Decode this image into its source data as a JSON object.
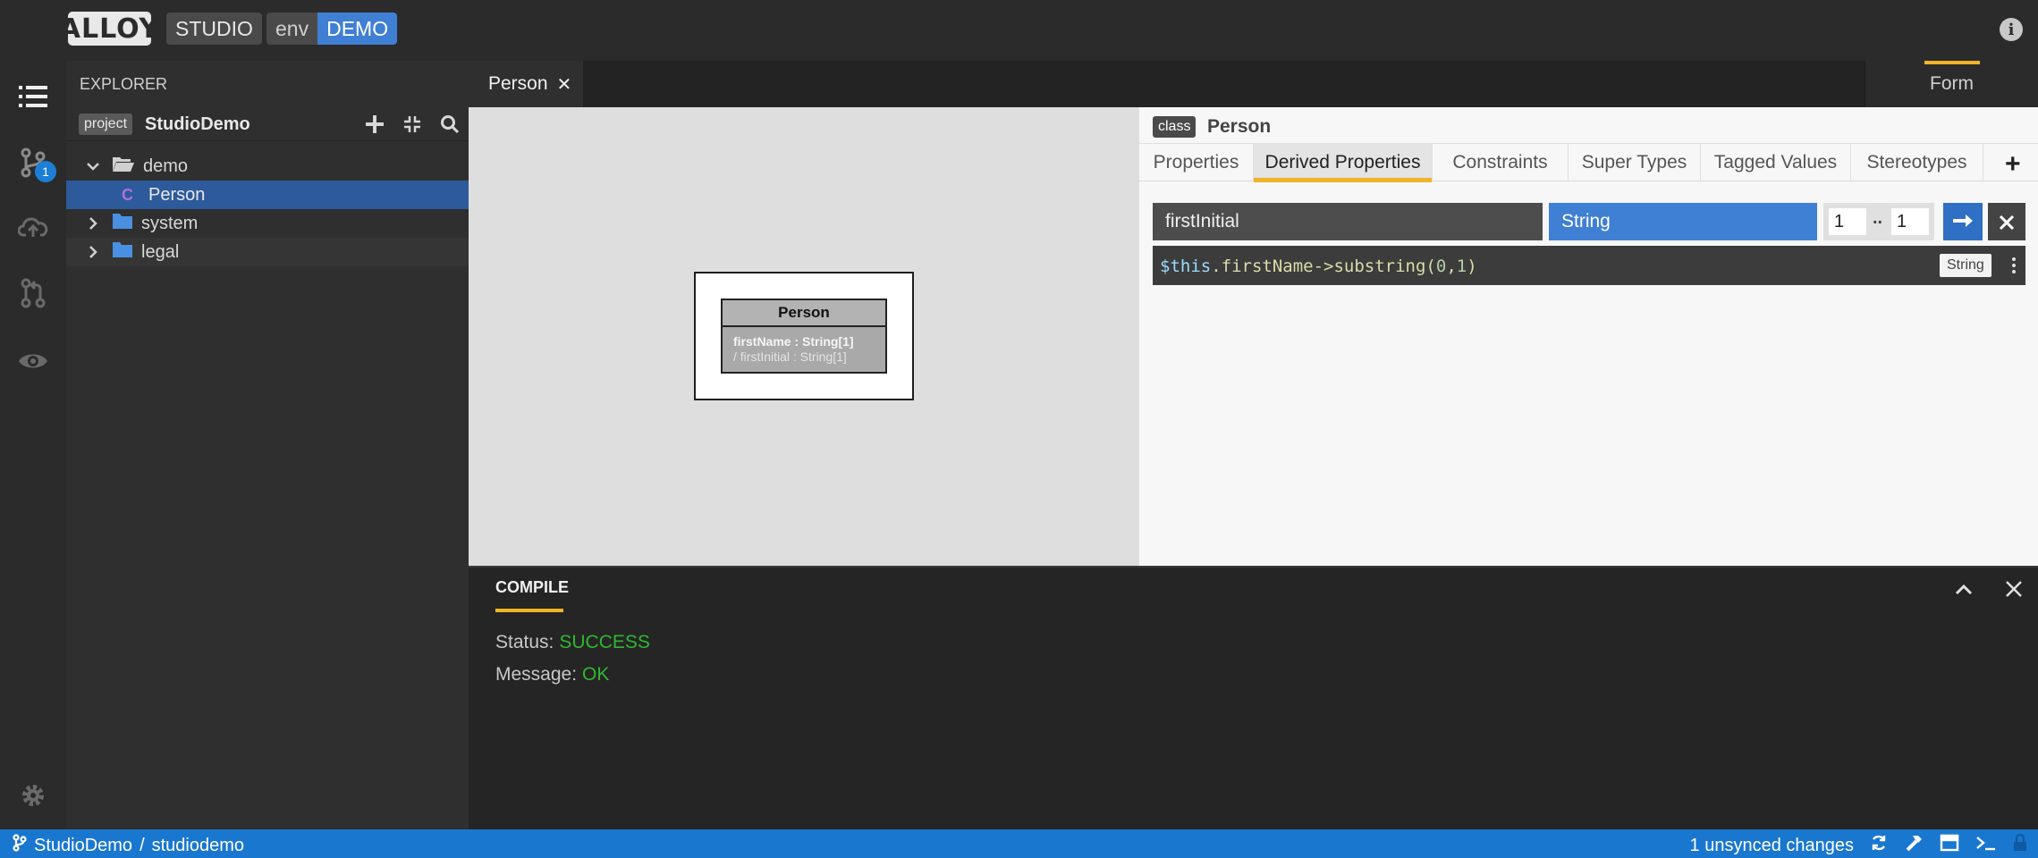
{
  "header": {
    "logo_text": "ALLOY",
    "studio_label": "STUDIO",
    "env_key": "env",
    "env_value": "DEMO"
  },
  "activity_bar": {
    "items": [
      {
        "icon": "list-icon",
        "active": true
      },
      {
        "icon": "git-branch-icon",
        "badge": "1"
      },
      {
        "icon": "cloud-upload-icon"
      },
      {
        "icon": "pull-request-icon"
      },
      {
        "icon": "eye-icon"
      }
    ],
    "settings_icon": "gear-icon"
  },
  "explorer": {
    "title": "EXPLORER",
    "project_tag": "project",
    "project_name": "StudioDemo",
    "tree": [
      {
        "label": "demo",
        "type": "folder-open",
        "expanded": true
      },
      {
        "label": "Person",
        "type": "class",
        "glyph": "C",
        "selected": true
      },
      {
        "label": "system",
        "type": "folder",
        "expanded": false
      },
      {
        "label": "legal",
        "type": "folder",
        "expanded": false
      }
    ]
  },
  "editor": {
    "tab_label": "Person",
    "tab_close": "✕",
    "mode_tab": "Form"
  },
  "diagram": {
    "class_name": "Person",
    "properties": [
      "firstName : String[1]",
      "/ firstInitial : String[1]"
    ]
  },
  "form": {
    "class_tag": "class",
    "class_name": "Person",
    "tabs": [
      "Properties",
      "Derived Properties",
      "Constraints",
      "Super Types",
      "Tagged Values",
      "Stereotypes"
    ],
    "active_tab": "Derived Properties",
    "derived_property": {
      "name": "firstInitial",
      "type": "String",
      "lower": "1",
      "upper": "1",
      "range_sep": "..",
      "expression_parts": {
        "var": "$this",
        "rest": ".firstName->substring(",
        "a0": "0",
        "comma": ",",
        "a1": "1",
        "close": ")"
      },
      "return_type": "String"
    }
  },
  "bottom_panel": {
    "tab": "COMPILE",
    "status_label": "Status:",
    "status_value": "SUCCESS",
    "message_label": "Message:",
    "message_value": "OK"
  },
  "status_bar": {
    "project": "StudioDemo",
    "separator": "/",
    "workspace": "studiodemo",
    "changes": "1 unsynced changes"
  },
  "colors": {
    "accent": "#f0b429",
    "selection": "#2d5a9a",
    "status_bar": "#1977cf",
    "success": "#2eb82e",
    "type_pill": "#3f7fd4"
  }
}
